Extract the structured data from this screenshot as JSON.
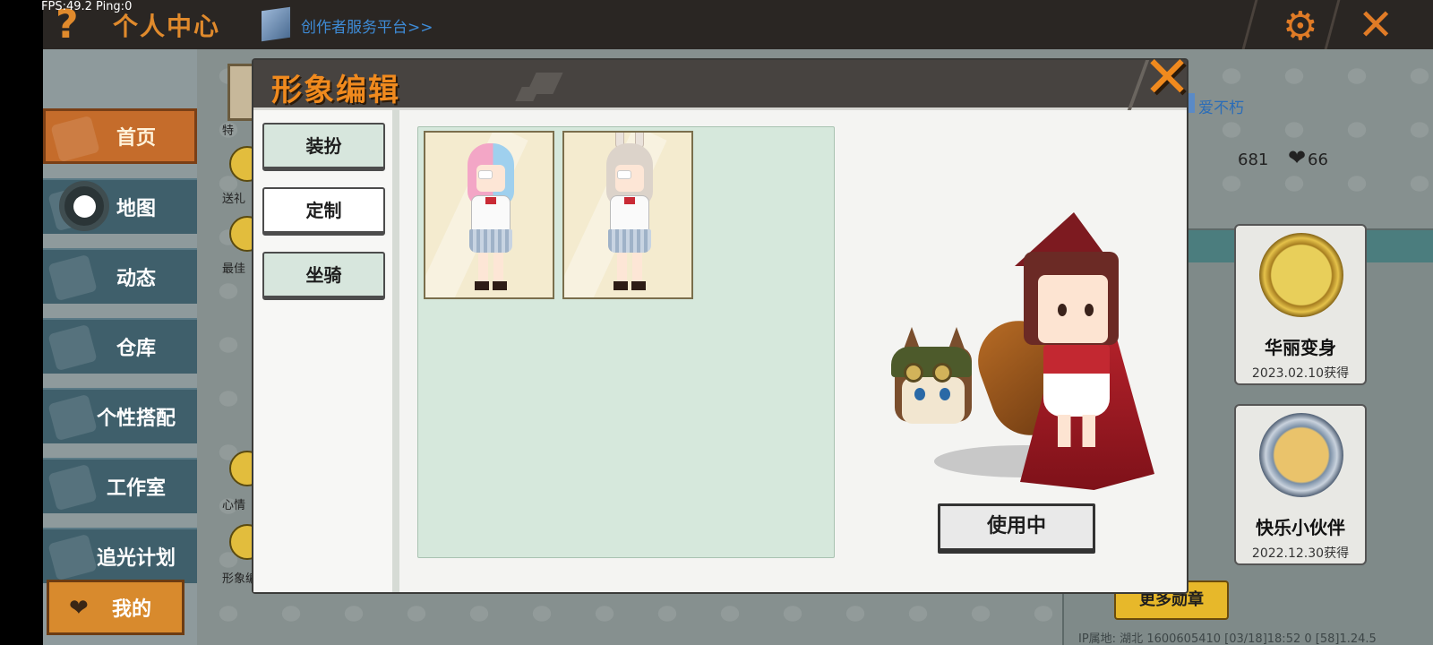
{
  "debug": {
    "fps_text": "FPS:49.2  Ping:0"
  },
  "topbar": {
    "help": "?",
    "title": "个人中心",
    "creator_link": "创作者服务平台>>",
    "settings_icon": "gear-icon",
    "close_icon": "close-icon"
  },
  "sidebar": {
    "items": [
      {
        "label": "首页",
        "icon": "home-icon",
        "active": true
      },
      {
        "label": "地图",
        "icon": "map-icon"
      },
      {
        "label": "动态",
        "icon": "bell-icon"
      },
      {
        "label": "仓库",
        "icon": "warehouse-icon"
      },
      {
        "label": "个性搭配",
        "icon": "outfit-icon"
      },
      {
        "label": "工作室",
        "icon": "studio-icon"
      },
      {
        "label": "追光计划",
        "icon": "plan-icon"
      }
    ],
    "mine_label": "我的"
  },
  "side_icons": [
    {
      "label": "特"
    },
    {
      "label": "送礼"
    },
    {
      "label": "最佳"
    },
    {
      "label": "心情"
    },
    {
      "label": "形象编辑"
    }
  ],
  "profile": {
    "friend_name": "爱不朽",
    "stat_a": "681",
    "stat_likes": "66"
  },
  "badges": [
    {
      "name": "华丽变身",
      "date": "2023.02.10获得"
    },
    {
      "name": "快乐小伙伴",
      "date": "2022.12.30获得"
    }
  ],
  "more_badges_label": "更多勋章",
  "footer_info": "IP属地: 湖北    1600605410    [03/18]18:52 0  [58]1.24.5",
  "modal": {
    "title": "形象编辑",
    "tabs": [
      {
        "label": "装扮",
        "selected": true
      },
      {
        "label": "定制",
        "selected": false
      },
      {
        "label": "坐骑",
        "selected": false
      }
    ],
    "skins": [
      {
        "name": "pink-blue-hair-skin",
        "hair_color": "#f3a6c6",
        "accent": "#9fd0ee"
      },
      {
        "name": "bunny-ear-skin",
        "hair_color": "#dcd3ca",
        "accent": "#eae2db"
      }
    ],
    "use_button_label": "使用中"
  },
  "colors": {
    "accent_orange": "#f08a1e",
    "panel_green": "#d6e8dc",
    "header_dark": "#474340"
  }
}
